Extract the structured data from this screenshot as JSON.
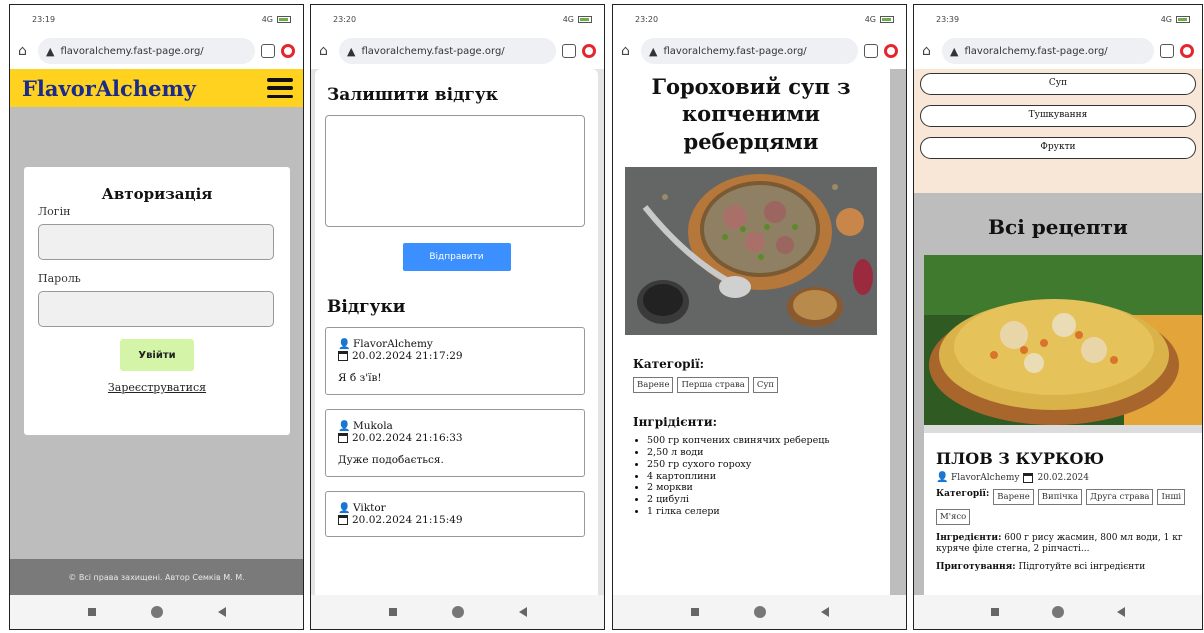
{
  "phones": [
    {
      "time": "23:19",
      "signal": "4G",
      "url": "flavoralchemy.fast-page.org/"
    },
    {
      "time": "23:20",
      "signal": "4G",
      "url": "flavoralchemy.fast-page.org/"
    },
    {
      "time": "23:20",
      "signal": "4G",
      "url": "flavoralchemy.fast-page.org/"
    },
    {
      "time": "23:39",
      "signal": "4G",
      "url": "flavoralchemy.fast-page.org/"
    }
  ],
  "login": {
    "brand": "FlavorAlchemy",
    "title": "Авторизація",
    "login_label": "Логін",
    "password_label": "Пароль",
    "login_value": "",
    "password_value": "",
    "submit_label": "Увійти",
    "register_label": "Зареєструватися",
    "footer": "© Всі права захищені. Автор Семків М. М."
  },
  "reviews": {
    "form_title": "Залишити відгук",
    "send_label": "Відправити",
    "list_title": "Відгуки",
    "items": [
      {
        "author": "FlavorAlchemy",
        "date": "20.02.2024 21:17:29",
        "text": "Я б з'їв!"
      },
      {
        "author": "Mukola",
        "date": "20.02.2024 21:16:33",
        "text": "Дуже подобається."
      },
      {
        "author": "Viktor",
        "date": "20.02.2024 21:15:49",
        "text": ""
      }
    ]
  },
  "recipe": {
    "title": "Гороховий суп з копченими реберцями",
    "categories_label": "Категорії:",
    "categories": [
      "Варене",
      "Перша страва",
      "Суп"
    ],
    "ingredients_label": "Інгрідієнти:",
    "ingredients": [
      "500 гр копчених свинячих реберець",
      "2,50 л води",
      "250 гр сухого гороху",
      "4 картоплини",
      "2 моркви",
      "2 цибулі",
      "1 гілка селери"
    ]
  },
  "all_recipes": {
    "categories": [
      "Суп",
      "Тушкування",
      "Фрукти"
    ],
    "title": "Всі рецепти",
    "card": {
      "name": "ПЛОВ З КУРКОЮ",
      "author": "FlavorAlchemy",
      "date": "20.02.2024",
      "categories_label": "Категорії:",
      "categories": [
        "Варене",
        "Випічка",
        "Друга страва",
        "Інші",
        "М'ясо"
      ],
      "ingredients_label": "Інгредієнти:",
      "ingredients_text": "600 г рису жасмин, 800 мл води, 1 кг куряче філе стегна, 2 ріпчасті...",
      "prep_label": "Приготування:",
      "prep_text": "Підготуйте всі інгредієнти"
    }
  },
  "colors": {
    "header_yellow": "#ffd21f",
    "brand_blue": "#1a2b8c",
    "send_blue": "#3b8fff",
    "login_green": "#d4f5a8",
    "cat_bar_peach": "#f8e6d6"
  }
}
